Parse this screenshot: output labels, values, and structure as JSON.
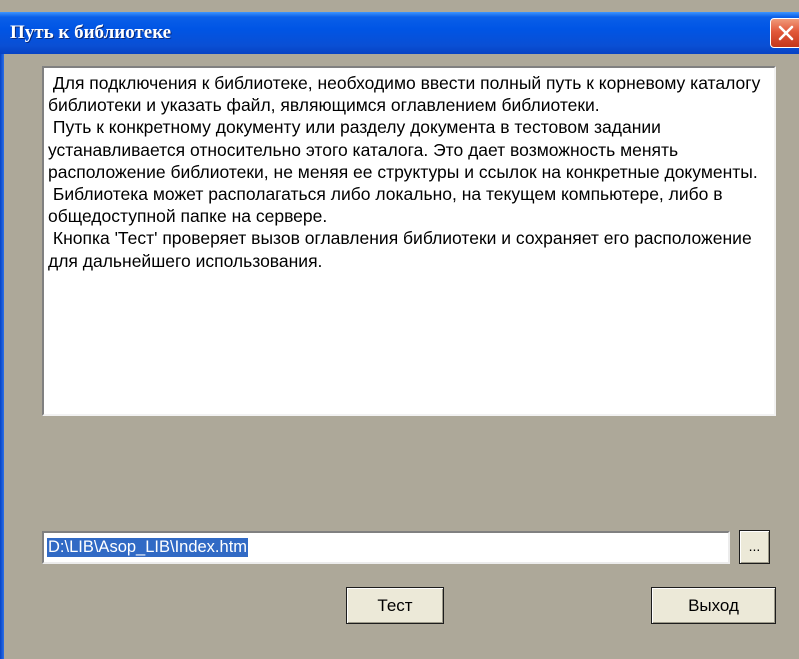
{
  "window": {
    "title": "Путь к библиотеке"
  },
  "info": {
    "paragraphs": [
      " Для подключения к библиотеке, необходимо ввести полный путь к корневому каталогу библиотеки и указать файл, являющимся оглавлением библиотеки.",
      " Путь к конкретному документу или разделу документа в тестовом задании устанавливается относительно этого каталога. Это дает возможность менять расположение библиотеки, не меняя ее структуры и ссылок на конкретные документы.",
      " Библиотека может располагаться либо локально, на текущем компьютере, либо в общедоступной папке на сервере.",
      " Кнопка 'Тест' проверяет вызов оглавления библиотеки и сохраняет его расположение для дальнейшего использования."
    ]
  },
  "path": {
    "value": "D:\\LIB\\Asop_LIB\\Index.htm"
  },
  "buttons": {
    "browse_label": "...",
    "test_label": "Тест",
    "exit_label": "Выход"
  },
  "colors": {
    "titlebar": "#0055e5",
    "dialog_background": "#ada899",
    "selection": "#316ac5",
    "close_button": "#e2583a"
  },
  "icons": {
    "close": "close-icon"
  }
}
